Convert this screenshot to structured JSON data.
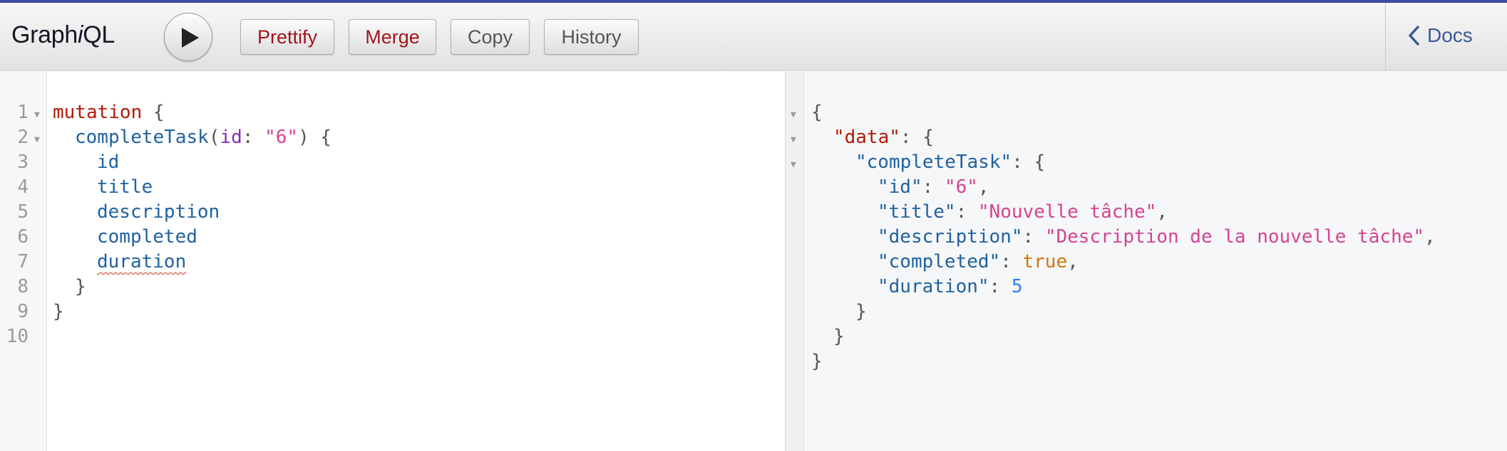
{
  "toolbar": {
    "title_prefix": "Graph",
    "title_italic": "i",
    "title_suffix": "QL",
    "prettify_label": "Prettify",
    "merge_label": "Merge",
    "copy_label": "Copy",
    "history_label": "History",
    "docs_label": "Docs"
  },
  "colors": {
    "accent": "#3b4ba5",
    "keyword": "#b11a04",
    "field": "#1f61a0",
    "argument": "#8b2bb9",
    "string": "#d64292",
    "boolean": "#d47509",
    "number": "#2882f9"
  },
  "query": {
    "line_numbers": [
      "1",
      "2",
      "3",
      "4",
      "5",
      "6",
      "7",
      "8",
      "9",
      "10"
    ],
    "keyword": "mutation",
    "open_brace": "{",
    "field": "completeTask",
    "paren_open": "(",
    "arg_name": "id",
    "arg_colon": ":",
    "arg_value": "\"6\"",
    "paren_close": ")",
    "selections": [
      "id",
      "title",
      "description",
      "completed",
      "duration"
    ],
    "close_brace": "}"
  },
  "result": {
    "open_brace": "{",
    "data_key": "\"data\"",
    "colon_brace": ": {",
    "complete_key": "\"completeTask\"",
    "rows": [
      {
        "key": "\"id\"",
        "value": "\"6\"",
        "type": "string",
        "trail": ","
      },
      {
        "key": "\"title\"",
        "value": "\"Nouvelle tâche\"",
        "type": "string",
        "trail": ","
      },
      {
        "key": "\"description\"",
        "value": "\"Description de la nouvelle tâche\"",
        "type": "string",
        "trail": ","
      },
      {
        "key": "\"completed\"",
        "value": "true",
        "type": "boolean",
        "trail": ","
      },
      {
        "key": "\"duration\"",
        "value": "5",
        "type": "number",
        "trail": ""
      }
    ],
    "close_brace": "}"
  }
}
